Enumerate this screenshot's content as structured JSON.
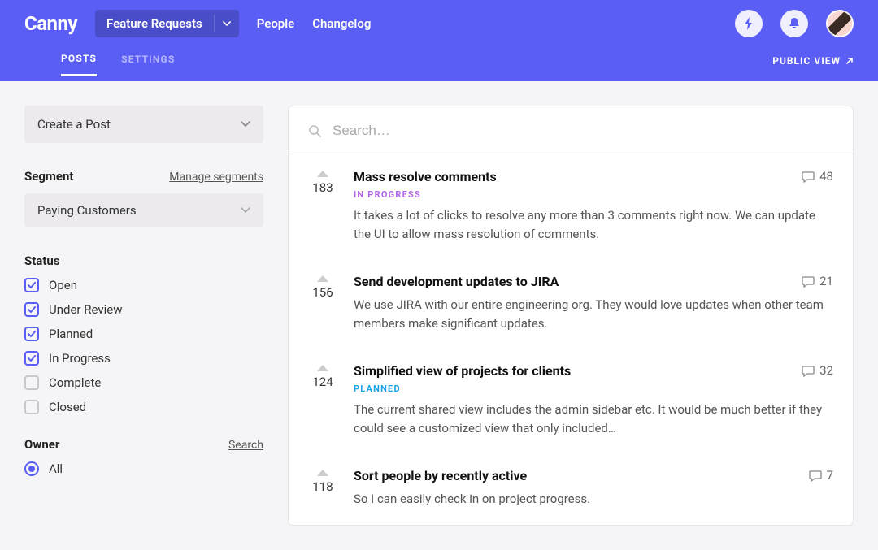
{
  "header": {
    "brand": "Canny",
    "board_selector": {
      "label": "Feature Requests"
    },
    "nav": {
      "people": "People",
      "changelog": "Changelog"
    },
    "tabs": {
      "posts": "POSTS",
      "settings": "SETTINGS"
    },
    "public_view": "PUBLIC VIEW"
  },
  "sidebar": {
    "create_post": "Create a Post",
    "segment": {
      "heading": "Segment",
      "manage": "Manage segments",
      "selected": "Paying Customers"
    },
    "status": {
      "heading": "Status",
      "options": [
        {
          "label": "Open",
          "checked": true
        },
        {
          "label": "Under Review",
          "checked": true
        },
        {
          "label": "Planned",
          "checked": true
        },
        {
          "label": "In Progress",
          "checked": true
        },
        {
          "label": "Complete",
          "checked": false
        },
        {
          "label": "Closed",
          "checked": false
        }
      ]
    },
    "owner": {
      "heading": "Owner",
      "search": "Search",
      "options": [
        {
          "label": "All",
          "checked": true
        }
      ]
    }
  },
  "main": {
    "search_placeholder": "Search…",
    "posts": [
      {
        "votes": "183",
        "title": "Mass resolve comments",
        "status": "IN PROGRESS",
        "status_class": "status-progress",
        "desc": "It takes a lot of clicks to resolve any more than 3 comments right now. We can update the UI to allow mass resolution of comments.",
        "comments": "48"
      },
      {
        "votes": "156",
        "title": "Send development updates to JIRA",
        "status": "",
        "status_class": "",
        "desc": "We use JIRA with our entire engineering org. They would love updates when other team members make significant updates.",
        "comments": "21"
      },
      {
        "votes": "124",
        "title": "Simplified view of projects for clients",
        "status": "PLANNED",
        "status_class": "status-planned",
        "desc": "The current shared view includes the admin sidebar etc. It would be much better if they could see a customized view that only included…",
        "comments": "32"
      },
      {
        "votes": "118",
        "title": "Sort people by recently active",
        "status": "",
        "status_class": "",
        "desc": "So I can easily check in on project progress.",
        "comments": "7"
      }
    ]
  }
}
